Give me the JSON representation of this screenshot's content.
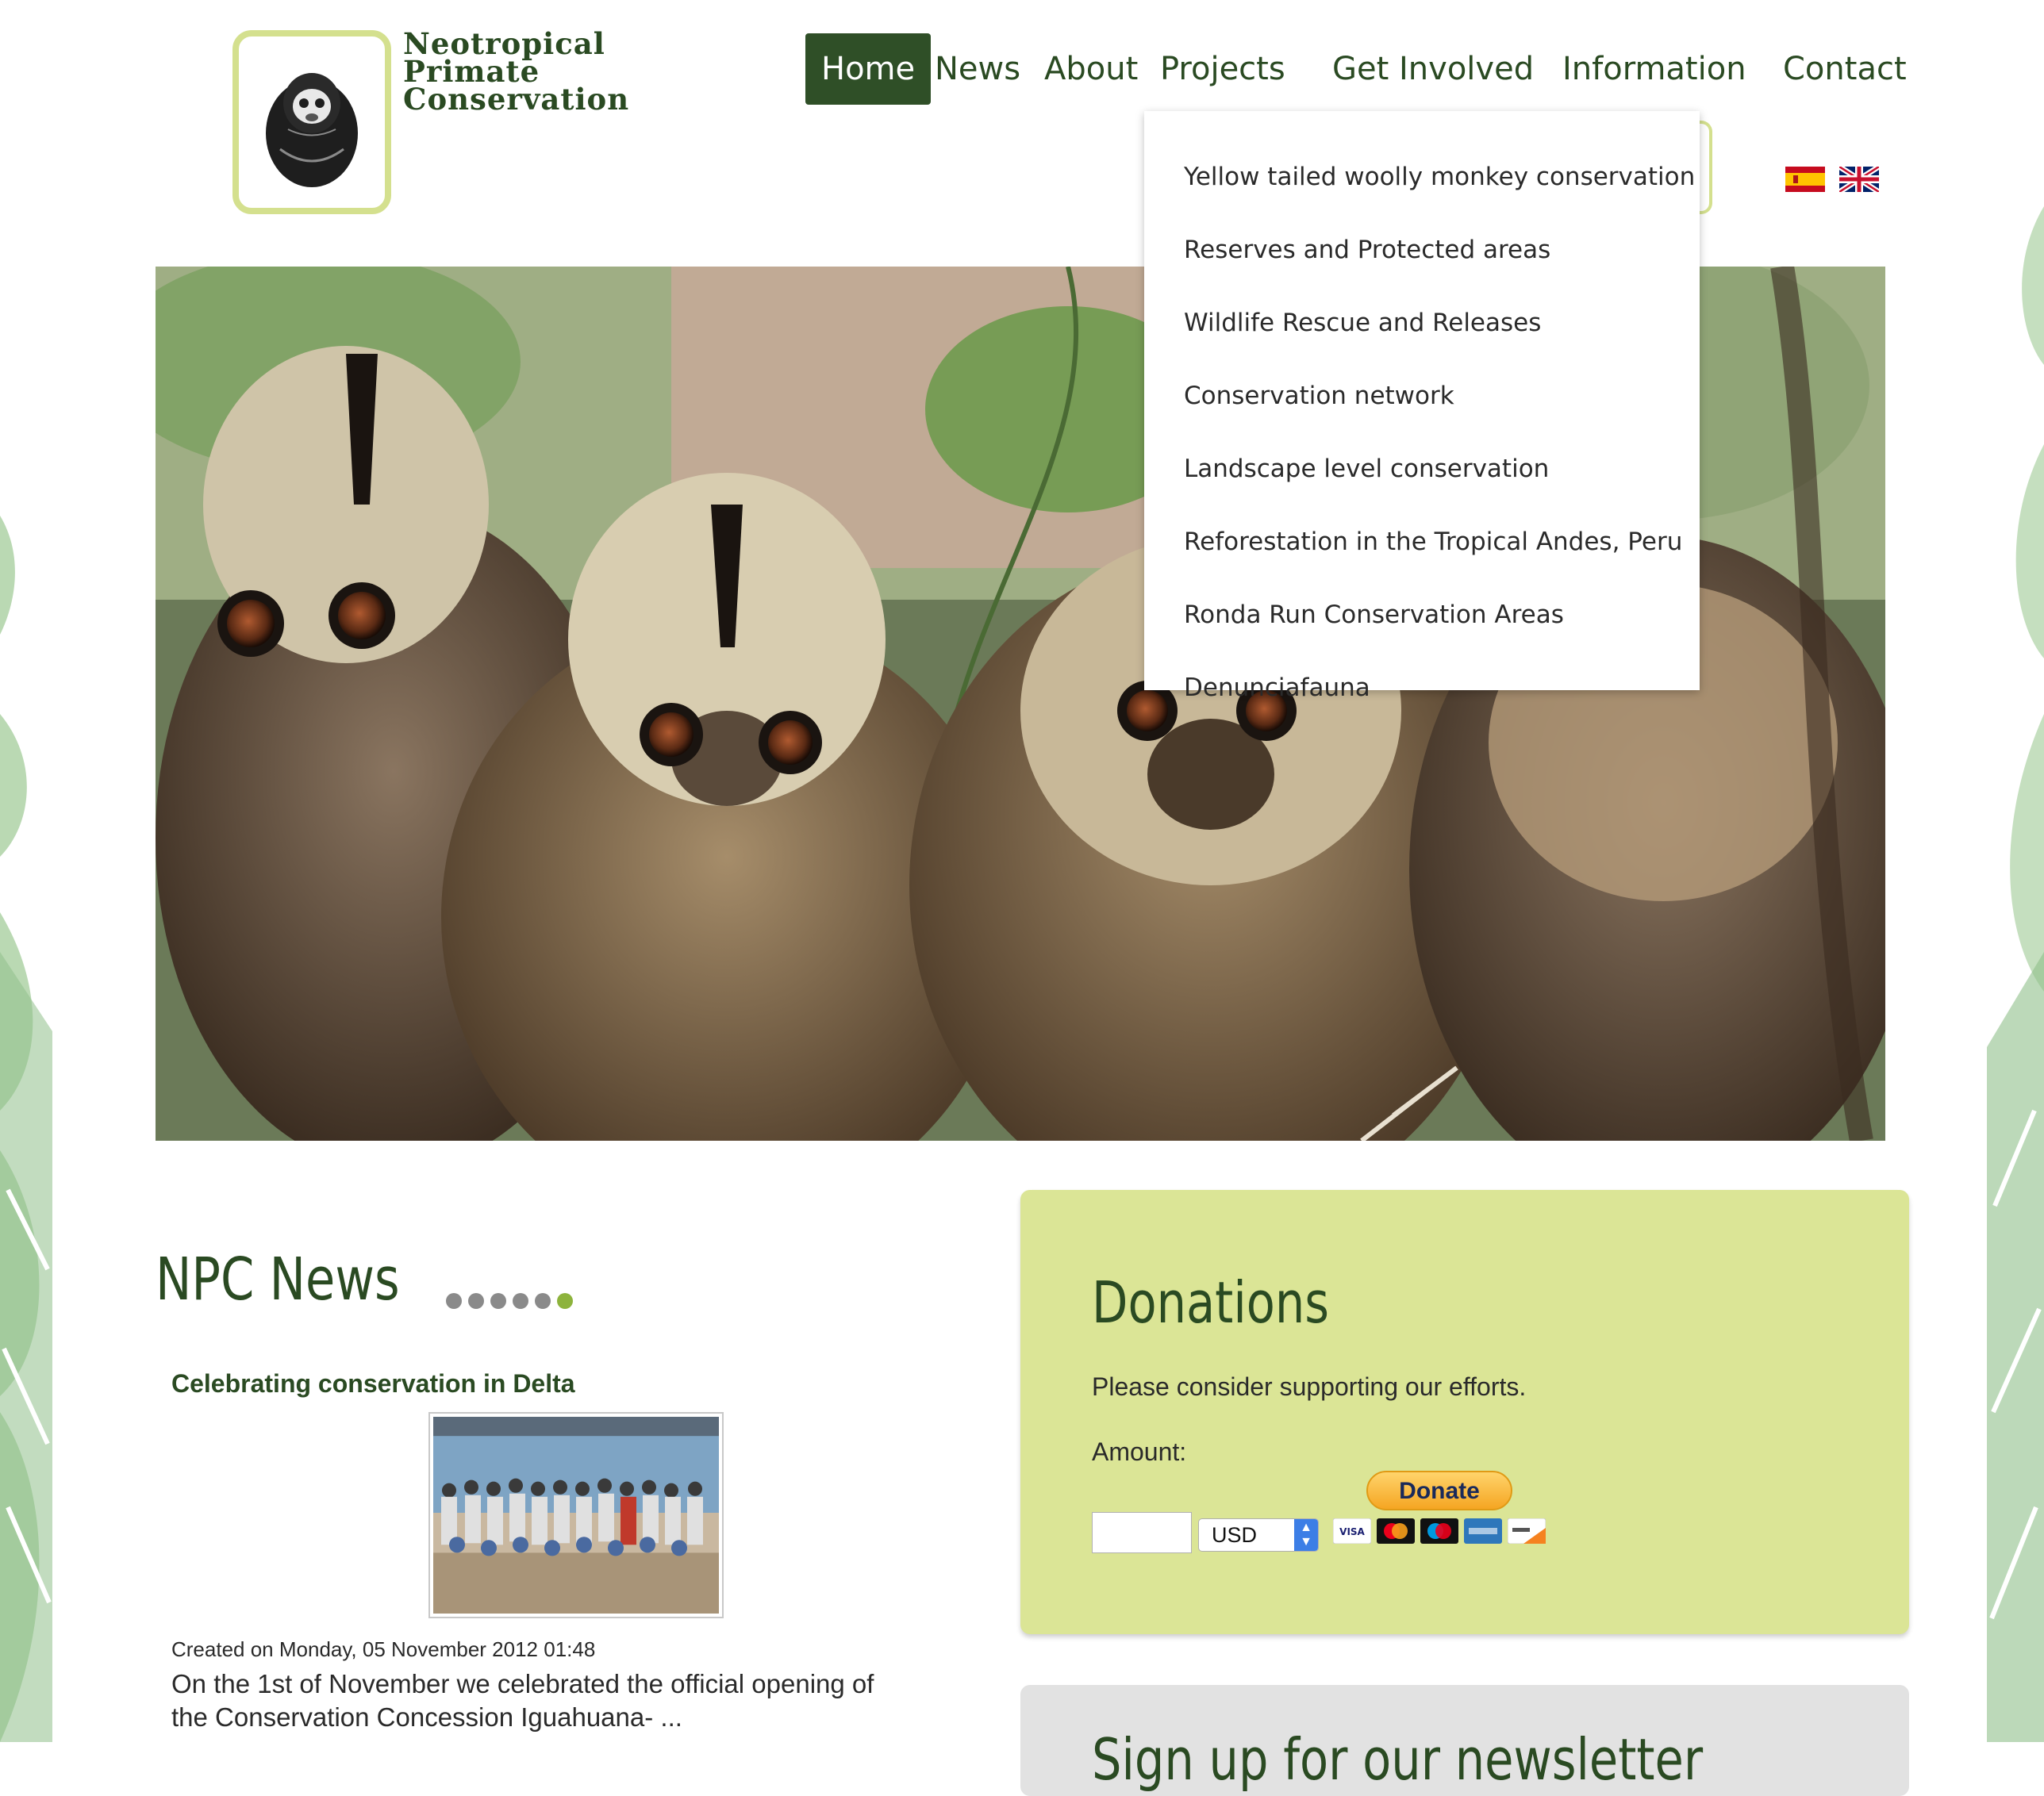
{
  "logo": {
    "lines": [
      "Neotropical",
      "Primate",
      "Conservation"
    ]
  },
  "nav": {
    "items": [
      {
        "label": "Home",
        "active": true
      },
      {
        "label": "News"
      },
      {
        "label": "About"
      },
      {
        "label": "Projects"
      },
      {
        "label": "Get Involved"
      },
      {
        "label": "Information"
      },
      {
        "label": "Contact"
      }
    ]
  },
  "projects_menu": {
    "items": [
      "Yellow tailed woolly monkey conservation",
      "Reserves and Protected areas",
      "Wildlife Rescue and Releases",
      "Conservation network",
      "Landscape level conservation",
      "Reforestation in the Tropical Andes, Peru",
      "Ronda Run Conservation Areas",
      "Denunciafauna"
    ]
  },
  "languages": [
    "spanish-flag-icon",
    "uk-flag-icon"
  ],
  "news": {
    "heading": "NPC News",
    "slides": 6,
    "active_slide": 6,
    "article": {
      "title": "Celebrating conservation in Delta",
      "created": "Created on Monday, 05 November 2012 01:48",
      "excerpt": "On the 1st of November we celebrated the official opening of the Conservation Concession Iguahuana- ..."
    }
  },
  "donations": {
    "heading": "Donations",
    "text": "Please consider supporting our efforts.",
    "amount_label": "Amount:",
    "amount_value": "",
    "currency": "USD",
    "donate_label": "Donate",
    "cards": [
      "visa-icon",
      "mastercard-icon",
      "maestro-icon",
      "amex-icon",
      "discover-icon"
    ]
  },
  "signup": {
    "heading": "Sign up for our newsletter"
  },
  "colors": {
    "brand_green": "#2f4f27",
    "accent_lime": "#dbe596",
    "logo_border": "#d4e08e"
  }
}
